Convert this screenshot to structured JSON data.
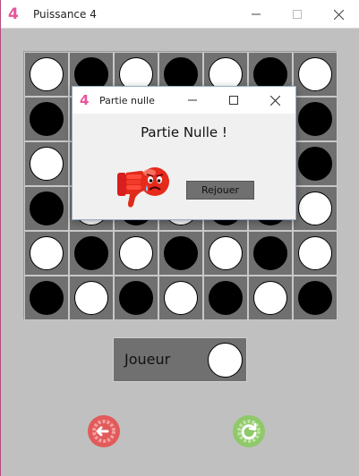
{
  "window": {
    "title": "Puissance 4",
    "icon_glyph": "4",
    "controls": [
      "minimize-icon",
      "maximize-icon",
      "close-icon"
    ]
  },
  "board": {
    "rows": 6,
    "cols": 7,
    "cells": [
      [
        "white",
        "black",
        "white",
        "black",
        "white",
        "black",
        "white"
      ],
      [
        "black",
        "white",
        "black",
        "white",
        "black",
        "white",
        "black"
      ],
      [
        "white",
        "black",
        "white",
        "black",
        "white",
        "black",
        "black"
      ],
      [
        "black",
        "white",
        "black",
        "white",
        "black",
        "black",
        "white"
      ],
      [
        "white",
        "black",
        "white",
        "black",
        "white",
        "black",
        "white"
      ],
      [
        "black",
        "white",
        "black",
        "white",
        "black",
        "white",
        "black"
      ]
    ]
  },
  "player": {
    "label": "Joueur",
    "current_disc": "white"
  },
  "buttons": {
    "back_icon": "back-arrow-icon",
    "restart_icon": "restart-icon"
  },
  "dialog": {
    "title": "Partie nulle",
    "icon_glyph": "4",
    "message": "Partie Nulle !",
    "button_label": "Rejouer",
    "image_icon": "sad-thumbs-down-icon"
  },
  "colors": {
    "background": "#c0c0c0",
    "board": "#707070",
    "app_icon": "#e8559a",
    "back_button": "#e25a5a",
    "restart_button": "#8fc96a"
  }
}
